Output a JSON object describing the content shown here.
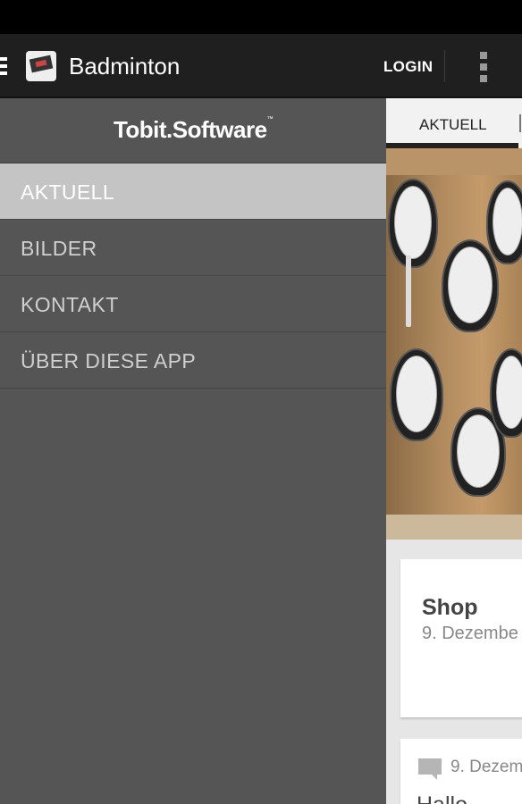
{
  "app": {
    "title": "Badminton",
    "login_label": "LOGIN",
    "brand": "Tobit.Software",
    "brand_mark": "™"
  },
  "drawer": {
    "items": [
      {
        "label": "AKTUELL",
        "active": true
      },
      {
        "label": "BILDER",
        "active": false
      },
      {
        "label": "KONTAKT",
        "active": false
      },
      {
        "label": "ÜBER DIESE APP",
        "active": false
      }
    ]
  },
  "content": {
    "tab_label": "AKTUELL",
    "card1": {
      "title": "Shop",
      "date": "9. Dezembe"
    },
    "card2": {
      "date": "9. Dezem",
      "text": "Hallo"
    }
  },
  "icons": [
    "menu-icon",
    "app-icon",
    "overflow-menu-icon",
    "comment-icon"
  ],
  "colors": {
    "actionbar": "#1f1f1f",
    "drawer": "#555555",
    "drawer_active": "#c4c4c4",
    "content_bg": "#e6e6e6"
  }
}
